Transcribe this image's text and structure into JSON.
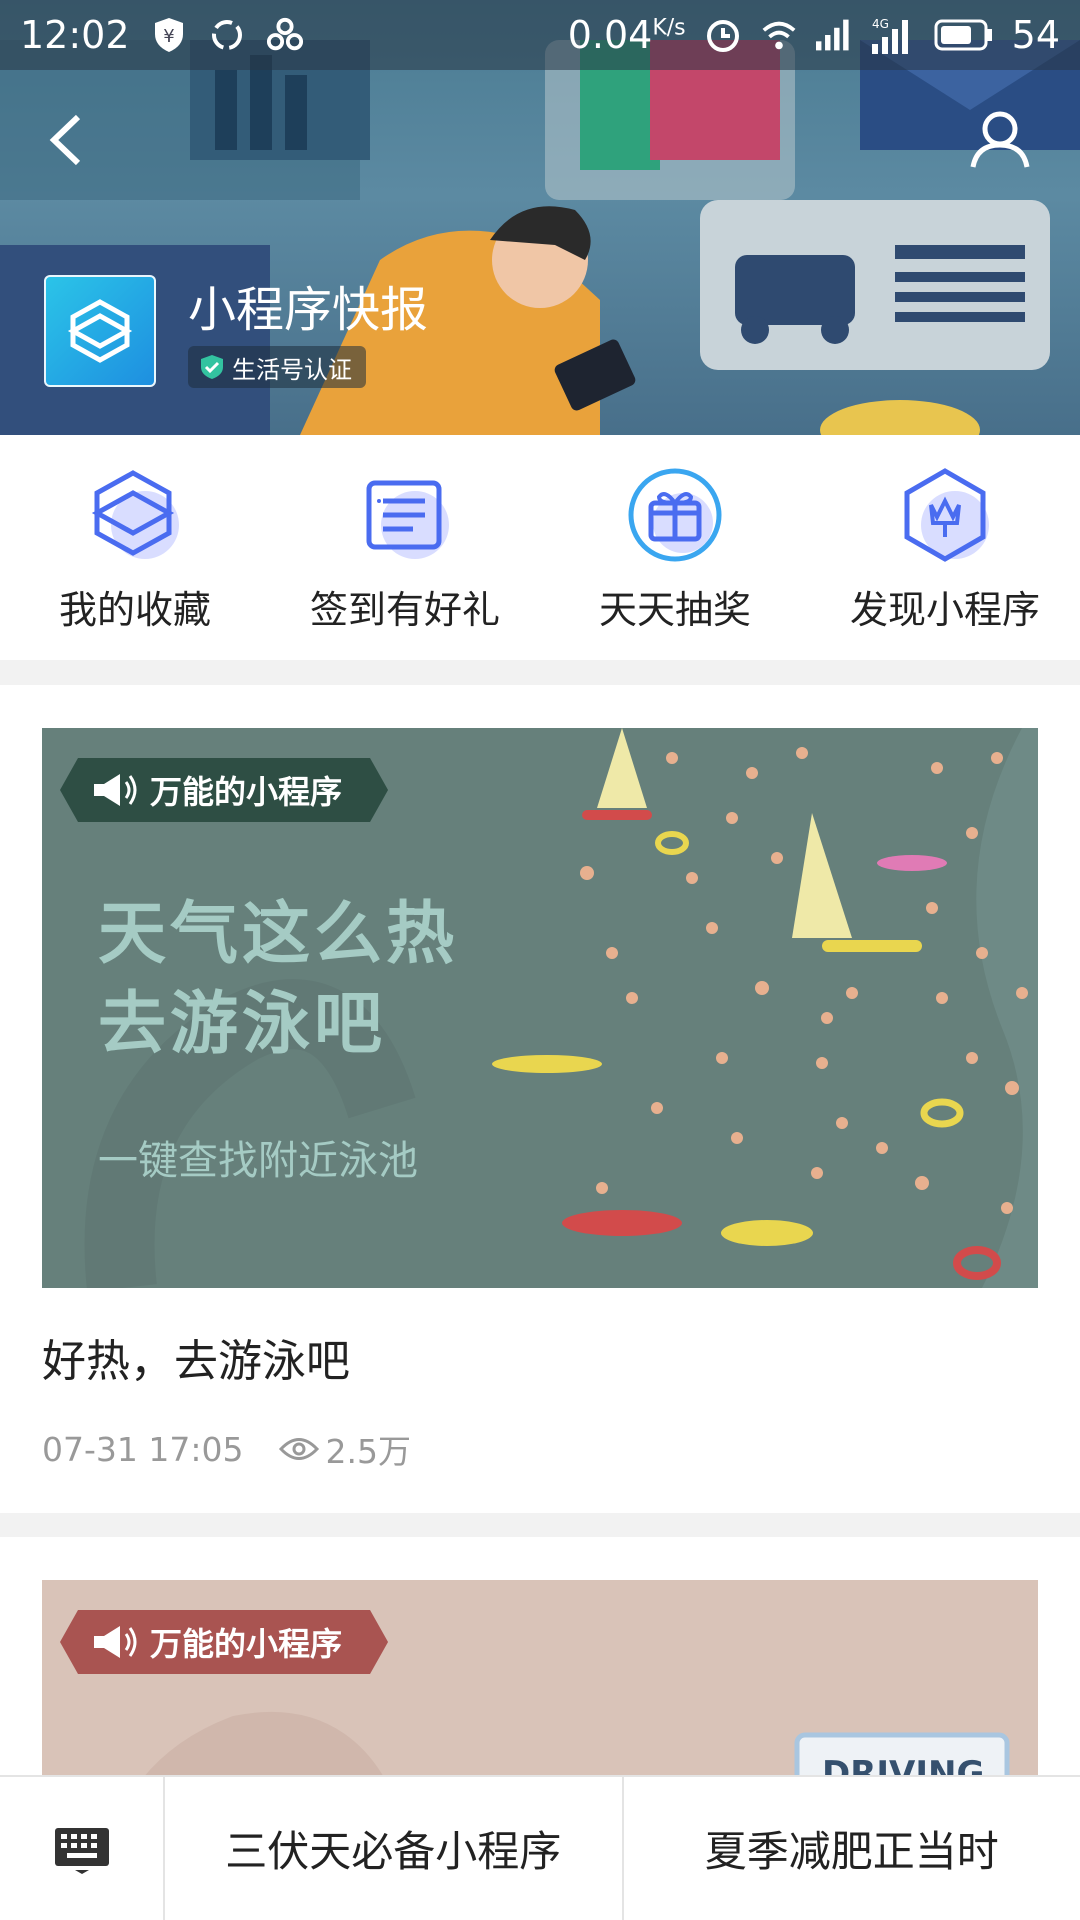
{
  "status_bar": {
    "time": "12:02",
    "net_speed": "0.04",
    "net_unit": "K/s",
    "network": "4G",
    "battery": "54"
  },
  "header": {
    "app_name": "小程序快报",
    "verified_label": "生活号认证"
  },
  "actions": [
    {
      "label": "我的收藏",
      "icon": "collection-icon"
    },
    {
      "label": "签到有好礼",
      "icon": "checkin-icon"
    },
    {
      "label": "天天抽奖",
      "icon": "gift-icon"
    },
    {
      "label": "发现小程序",
      "icon": "discover-icon"
    }
  ],
  "articles": [
    {
      "tag": "万能的小程序",
      "banner_line1": "天气这么热",
      "banner_line2": "去游泳吧",
      "banner_sub": "一键查找附近泳池",
      "title": "好热，去游泳吧",
      "time": "07-31 17:05",
      "views": "2.5万"
    },
    {
      "tag": "万能的小程序",
      "banner_word": "DRIVING"
    }
  ],
  "bottom_menu": [
    "三伏天必备小程序",
    "夏季减肥正当时"
  ],
  "colors": {
    "accent": "#1e8fe0",
    "banner1_bg": "#66807b",
    "banner2_bg": "#d9c3b8",
    "tag1": "#2e4e44",
    "tag2": "#a95451"
  }
}
